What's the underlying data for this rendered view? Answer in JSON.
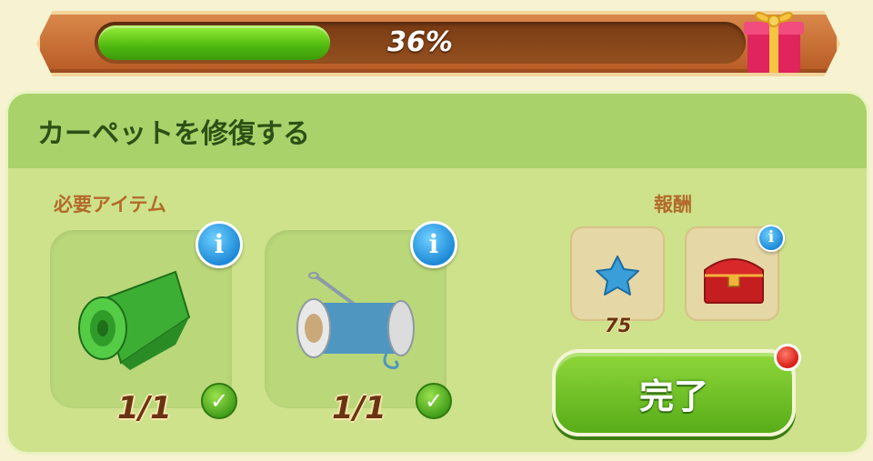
{
  "progress": {
    "value": 0.36,
    "label": "36%"
  },
  "task": {
    "title": "カーペットを修復する"
  },
  "required": {
    "label": "必要アイテム",
    "items": [
      {
        "icon": "fabric-roll-icon",
        "count": "1/1",
        "complete": true
      },
      {
        "icon": "thread-spool-icon",
        "count": "1/1",
        "complete": true
      }
    ]
  },
  "rewards": {
    "label": "報酬",
    "items": [
      {
        "icon": "blue-star-icon",
        "value": "75"
      },
      {
        "icon": "red-chest-icon",
        "value": ""
      }
    ]
  },
  "actions": {
    "complete_label": "完了"
  },
  "colors": {
    "progress_fill": "#4fb80f",
    "header_frame": "#c96f34",
    "panel_bg": "#cde28b",
    "title_text": "#2c5016",
    "section_label": "#b36a2a"
  }
}
